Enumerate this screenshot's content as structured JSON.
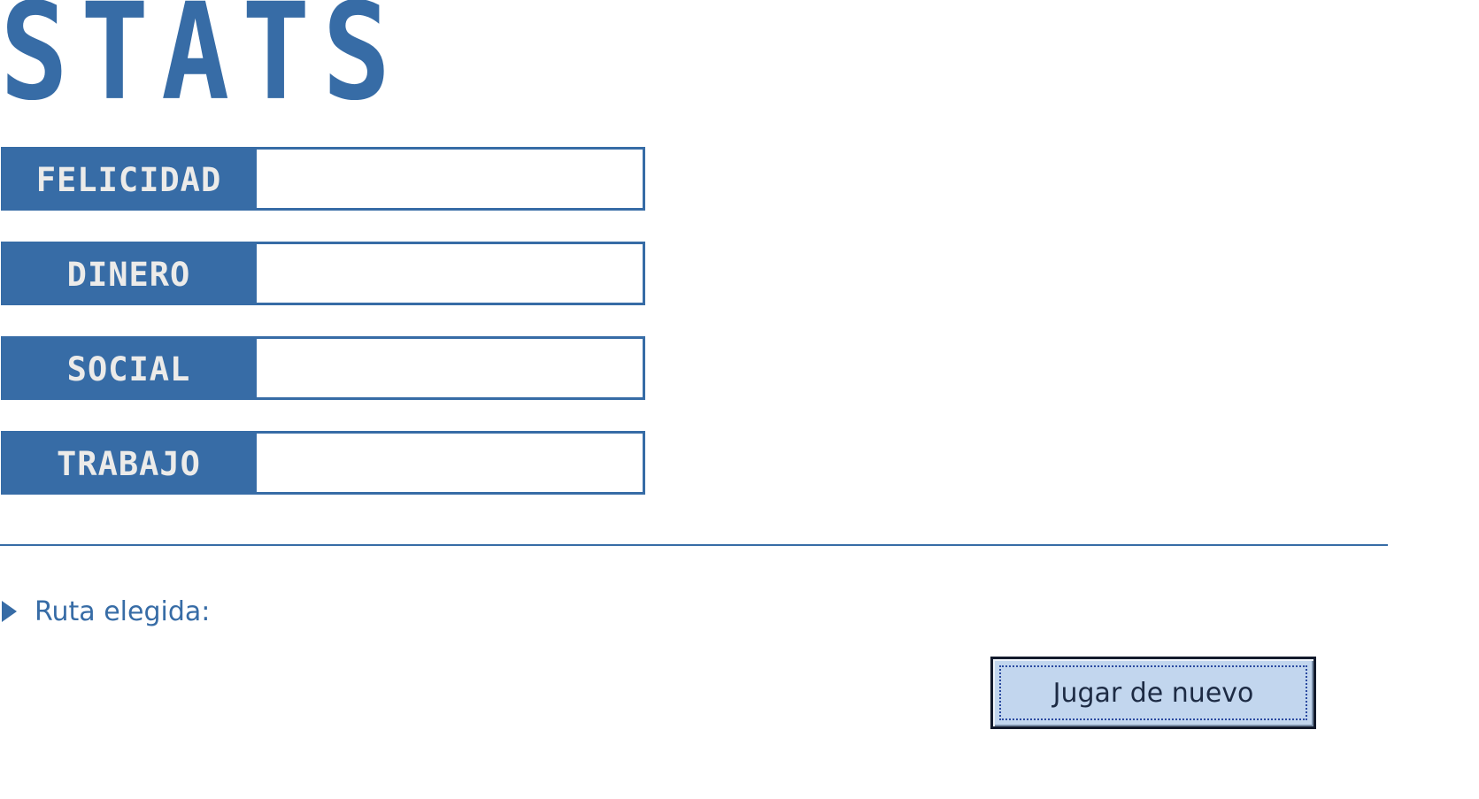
{
  "title": "STATS",
  "stats": [
    {
      "label": "FELICIDAD",
      "value": 0
    },
    {
      "label": "DINERO",
      "value": 0
    },
    {
      "label": "SOCIAL",
      "value": 0
    },
    {
      "label": "TRABAJO",
      "value": 0
    }
  ],
  "route": {
    "label": "Ruta elegida:",
    "value": ""
  },
  "replay_button": {
    "label": "Jugar de nuevo"
  },
  "colors": {
    "accent": "#376ca6",
    "label_text": "#ecebe9",
    "button_bg": "#c2d6ee",
    "button_border": "#121a2c"
  }
}
